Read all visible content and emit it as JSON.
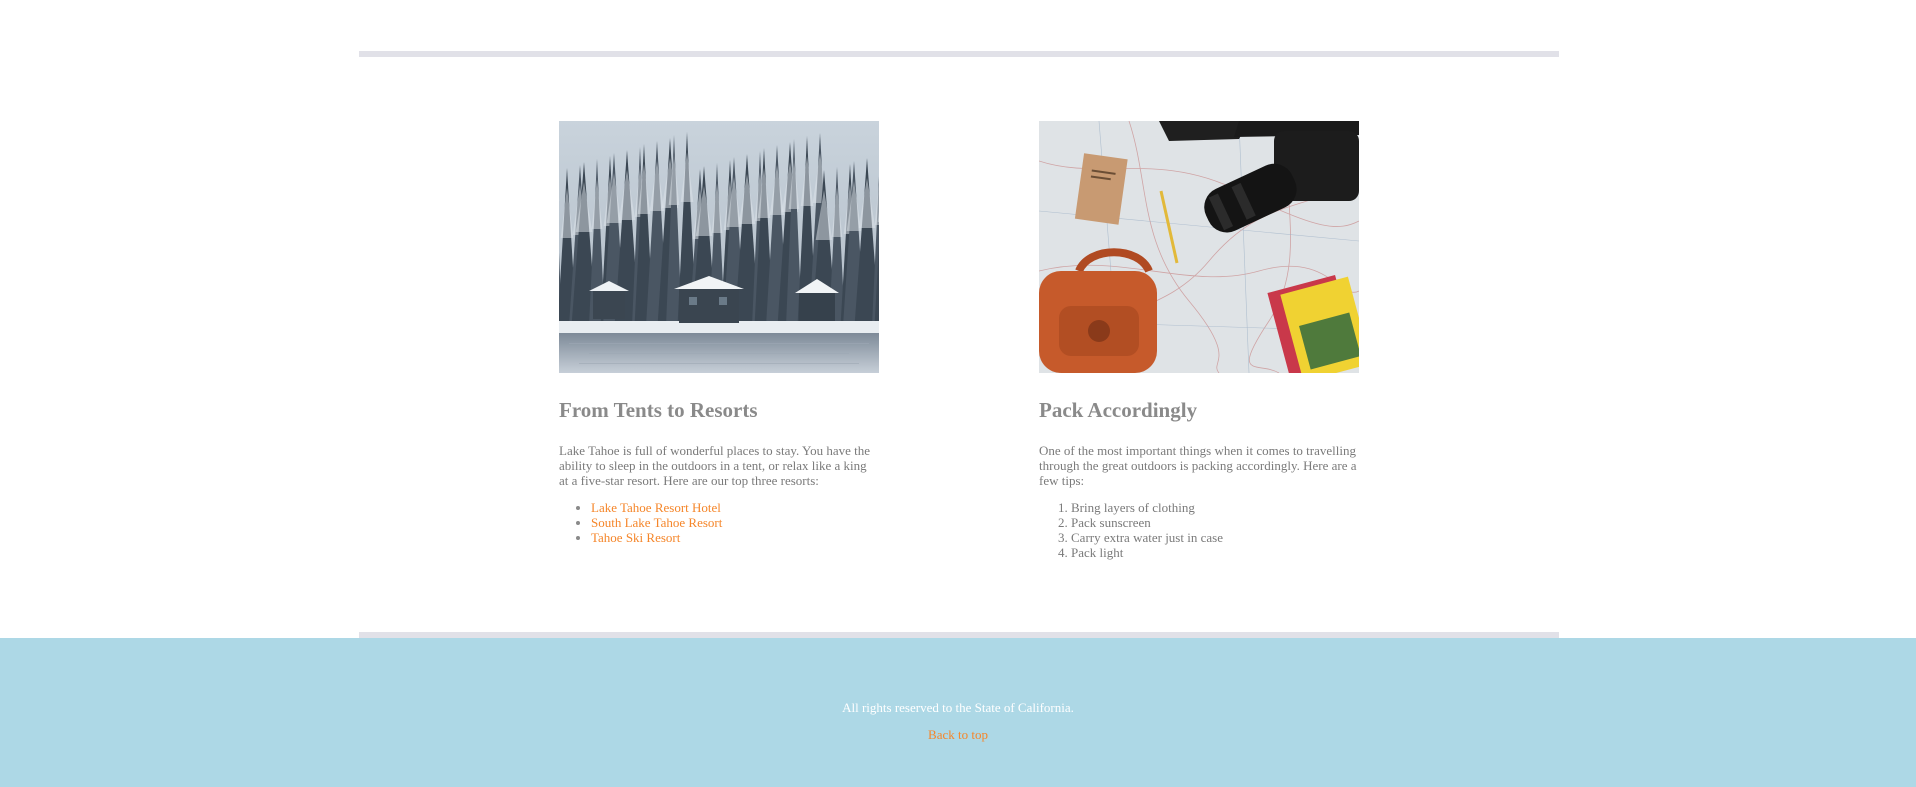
{
  "articles": [
    {
      "image": "snowy-lake-cabins",
      "title": "From Tents to Resorts",
      "body": "Lake Tahoe is full of wonderful places to stay. You have the ability to sleep in the outdoors in a tent, or relax like a king at a five-star resort. Here are our top three resorts:",
      "links": [
        "Lake Tahoe Resort Hotel",
        "South Lake Tahoe Resort",
        "Tahoe Ski Resort"
      ]
    },
    {
      "image": "map-with-camera-and-backpack",
      "title": "Pack Accordingly",
      "body": "One of the most important things when it comes to travelling through the great outdoors is packing accordingly. Here are a few tips:",
      "tips": [
        "Bring layers of clothing",
        "Pack sunscreen",
        "Carry extra water just in case",
        "Pack light"
      ]
    }
  ],
  "footer": {
    "copyright": "All rights reserved to the State of California.",
    "back_to_top": "Back to top"
  },
  "colors": {
    "link": "#f5862a",
    "footer_bg": "#add8e6",
    "rule": "#e1e1e8",
    "text": "#7a7a7a"
  }
}
